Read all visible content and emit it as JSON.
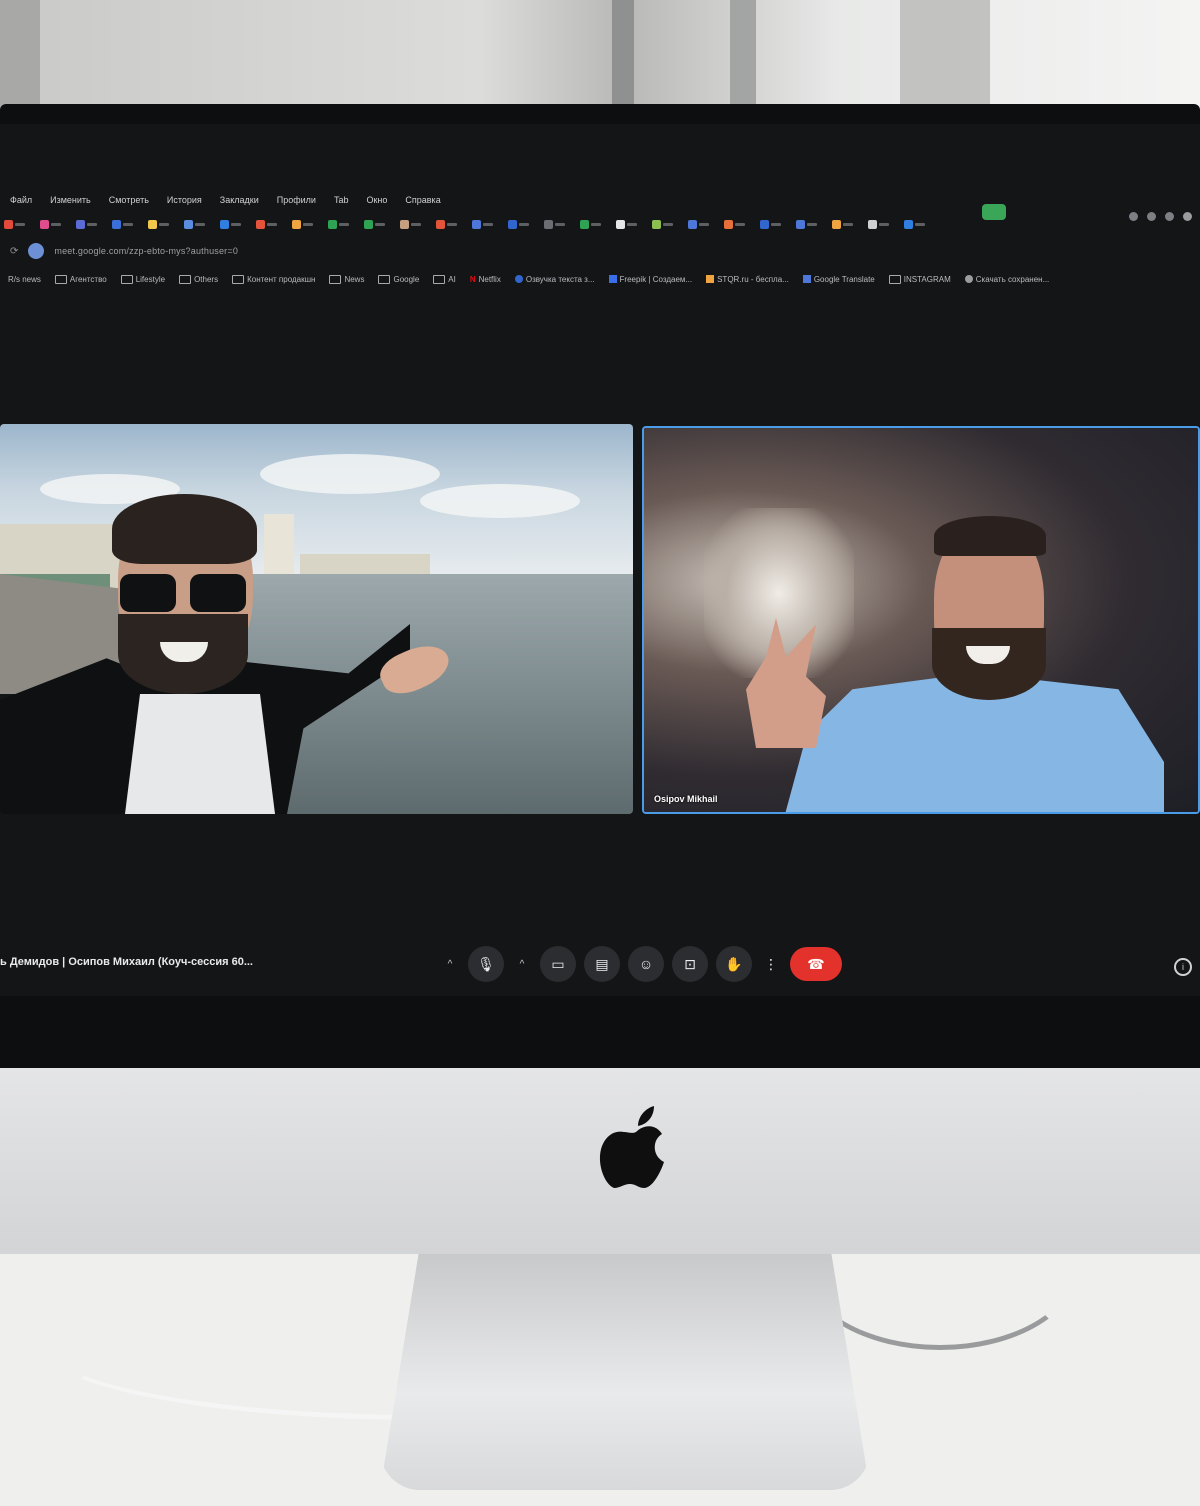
{
  "menu": [
    "Файл",
    "Изменить",
    "Смотреть",
    "История",
    "Закладки",
    "Профили",
    "Tab",
    "Окно",
    "Справка"
  ],
  "address": {
    "url": "meet.google.com/zzp-ebto-mys?authuser=0"
  },
  "bookmarks": [
    "R/s news",
    "Агентство",
    "Lifestyle",
    "Others",
    "Контент продакшн",
    "News",
    "Google",
    "AI",
    "Netflix",
    "Озвучка текста з...",
    "Freepik | Создаем...",
    "STQR.ru - беспла...",
    "Google Translate",
    "INSTAGRAM",
    "Скачать сохранен..."
  ],
  "meeting": {
    "title": "ь Демидов | Осипов Михаил (Коуч-сессия 60...",
    "participant_right": "Osipov Mikhail"
  },
  "toolbar": {
    "caret": "^",
    "mic_icon": "🎙",
    "camera_icon": "▭",
    "captions_icon": "▤",
    "emoji_icon": "☺",
    "present_icon": "⊡",
    "hand_icon": "✋",
    "more_icon": "⋮",
    "end_icon": "☎",
    "info_icon": "i"
  },
  "colors": {
    "end_call": "#e3312b",
    "active_speaker_border": "#4a9be8",
    "screen_bg": "#141517"
  }
}
